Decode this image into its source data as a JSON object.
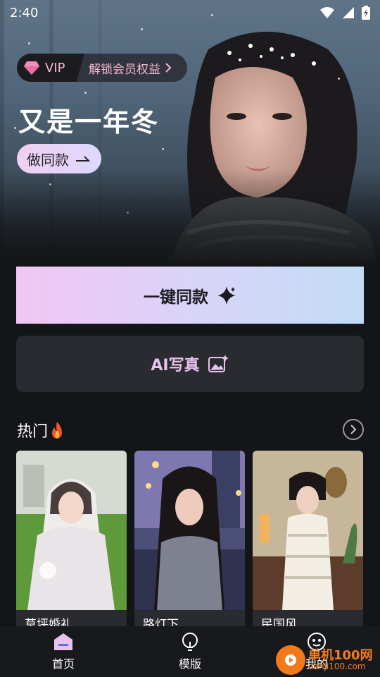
{
  "status_bar": {
    "time": "2:40"
  },
  "hero": {
    "vip_label": "VIP",
    "vip_cta": "解锁会员权益",
    "title": "又是一年冬",
    "same_button": "做同款"
  },
  "actions": {
    "one_click": "一键同款",
    "ai_photo": "AI写真"
  },
  "hot": {
    "title": "热门",
    "cards": [
      {
        "caption": "草坪婚礼"
      },
      {
        "caption": "路灯下"
      },
      {
        "caption": "民国风"
      }
    ]
  },
  "nav": {
    "items": [
      {
        "label": "首页",
        "icon": "home-icon",
        "active": true
      },
      {
        "label": "模版",
        "icon": "bulb-icon",
        "active": false
      },
      {
        "label": "我的",
        "icon": "face-icon",
        "active": false
      }
    ]
  },
  "watermark": {
    "brand": "单机100网",
    "domain": "danji100.com"
  },
  "colors": {
    "accent_pink": "#f3b9d0",
    "gradient_start": "#f2c6f4",
    "gradient_end": "#c2dcf6",
    "background": "#141518"
  }
}
